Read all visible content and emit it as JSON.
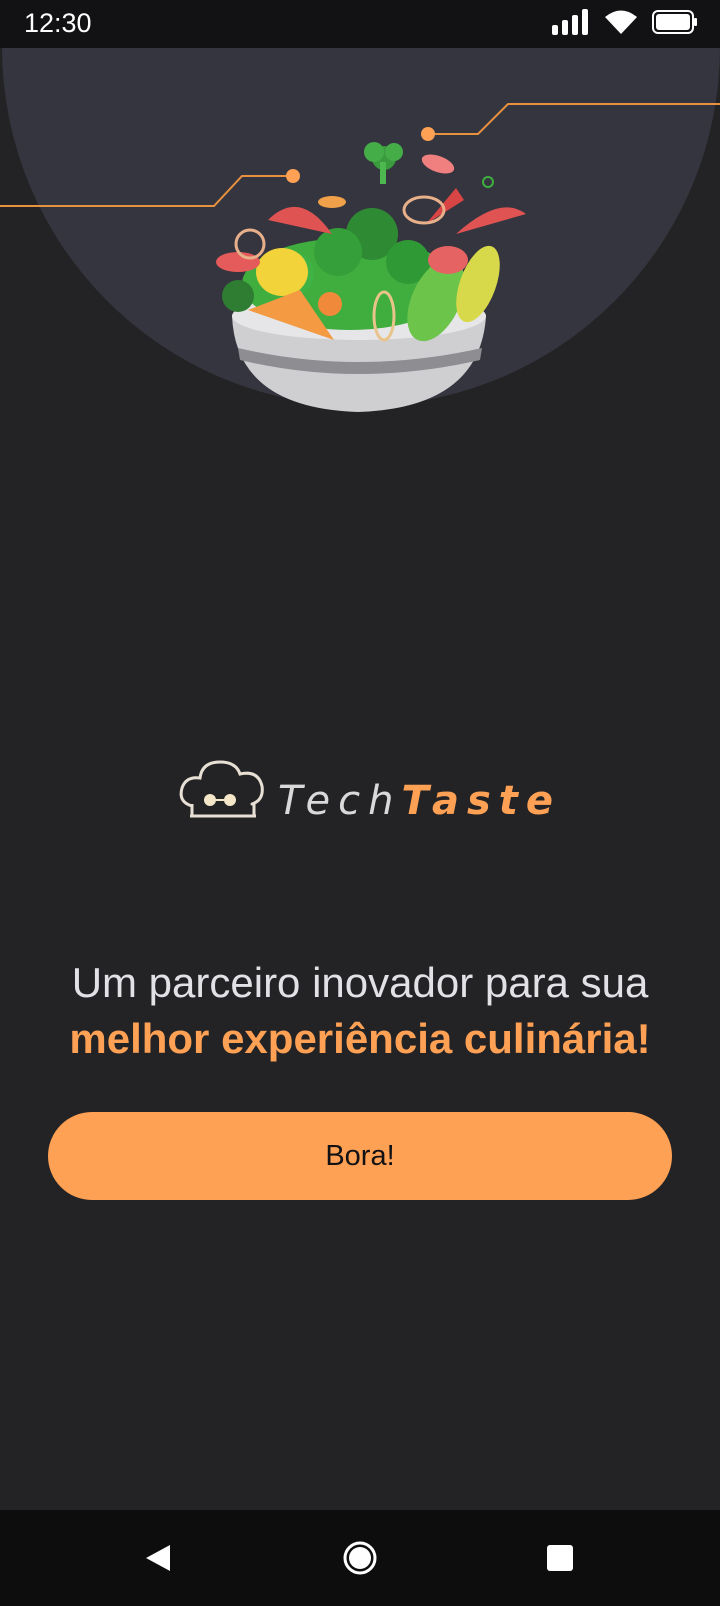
{
  "status_bar": {
    "time": "12:30",
    "icons": [
      "signal-icon",
      "wifi-icon",
      "battery-icon"
    ]
  },
  "hero": {
    "illustration": "salad-bowl-illustration"
  },
  "logo": {
    "icon": "chef-hat-glasses-icon",
    "text_part1": "Tech",
    "text_part2": "Taste"
  },
  "tagline": {
    "line1": "Um parceiro inovador para sua",
    "line2": "melhor experiência culinária!"
  },
  "cta": {
    "label": "Bora!"
  },
  "nav_bar": {
    "icons": [
      "back-icon",
      "home-icon",
      "recent-apps-icon"
    ]
  },
  "colors": {
    "background": "#232326",
    "accent": "#ffa154",
    "hero_circle": "#35353f",
    "text_light": "#e1e1e6"
  }
}
